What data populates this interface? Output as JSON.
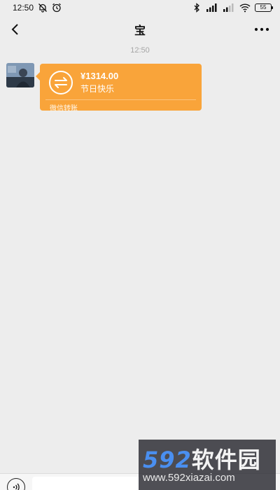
{
  "status_bar": {
    "time": "12:50",
    "battery": "55",
    "icons": [
      "mute-bell-icon",
      "alarm-icon",
      "bluetooth-icon",
      "signal-icon",
      "wifi-icon",
      "battery-icon"
    ]
  },
  "header": {
    "title": "宝",
    "back_icon": "chevron-left-icon",
    "more_icon": "more-dots-icon"
  },
  "chat": {
    "timestamp": "12:50",
    "messages": [
      {
        "type": "transfer",
        "amount": "¥1314.00",
        "note": "节日快乐",
        "footer": "微信转账",
        "color": "#f9a43a"
      }
    ]
  },
  "input_bar": {
    "voice_icon": "voice-icon"
  },
  "watermark": {
    "brand_num": "592",
    "brand_text": "软件园",
    "url": "www.592xiazai.com"
  }
}
